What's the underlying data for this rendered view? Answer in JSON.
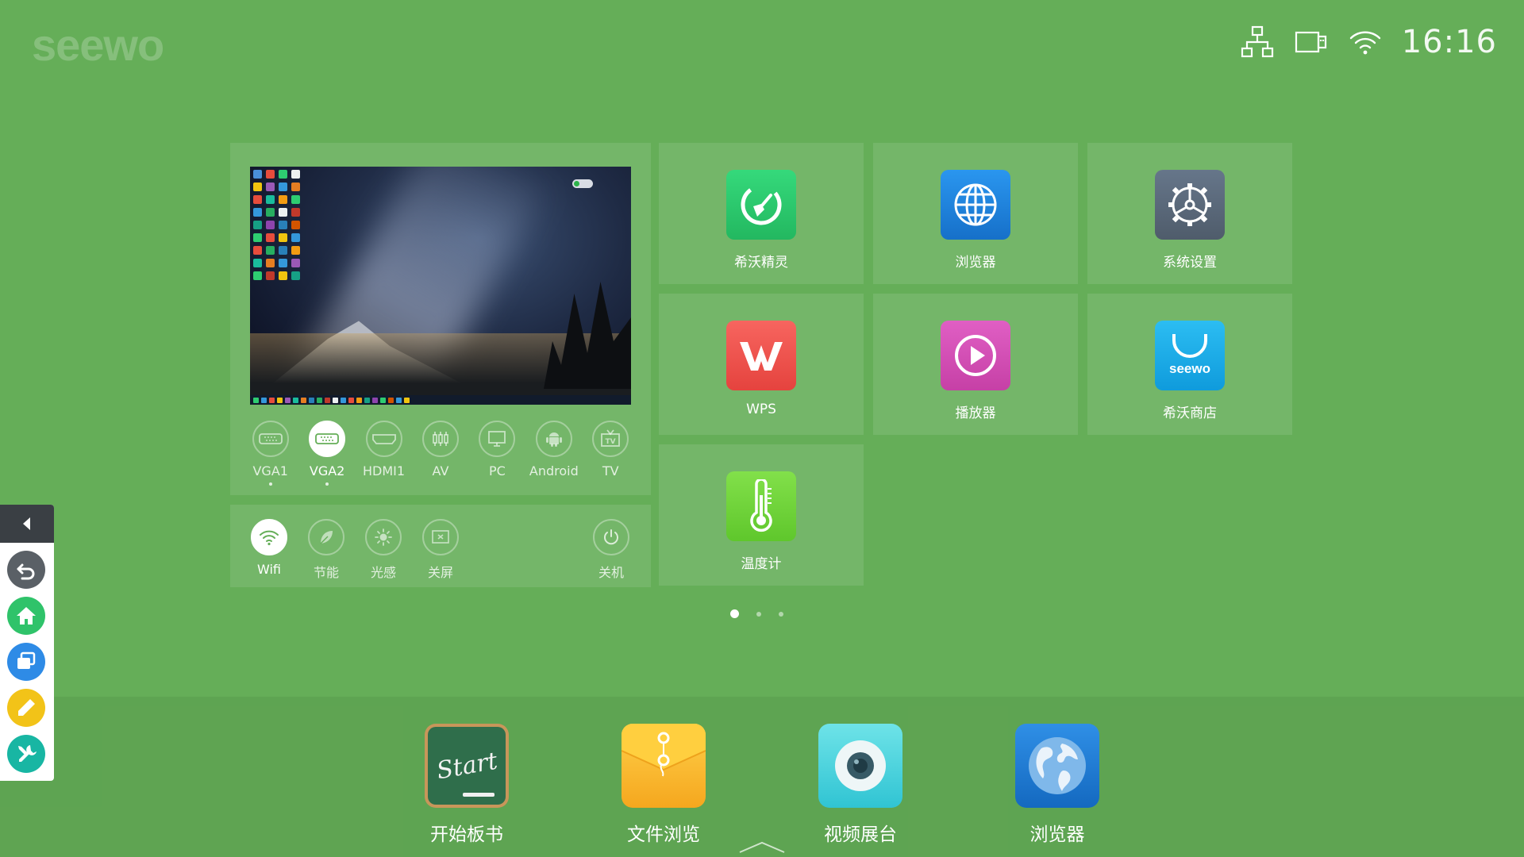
{
  "header": {
    "logo_text": "seewo",
    "clock": "16:16",
    "status_icons": [
      "network-icon",
      "usb-drive-icon",
      "wifi-icon"
    ]
  },
  "sources": {
    "items": [
      {
        "label": "VGA1",
        "icon": "vga-port-icon",
        "active": false,
        "has_dot": true
      },
      {
        "label": "VGA2",
        "icon": "vga-port-icon",
        "active": true,
        "has_dot": true
      },
      {
        "label": "HDMI1",
        "icon": "hdmi-port-icon",
        "active": false,
        "has_dot": false
      },
      {
        "label": "AV",
        "icon": "av-port-icon",
        "active": false,
        "has_dot": false
      },
      {
        "label": "PC",
        "icon": "pc-icon",
        "active": false,
        "has_dot": false
      },
      {
        "label": "Android",
        "icon": "android-icon",
        "active": false,
        "has_dot": false
      },
      {
        "label": "TV",
        "icon": "tv-icon",
        "active": false,
        "has_dot": false
      }
    ]
  },
  "quick_settings": {
    "wifi": "Wifi",
    "eco": "节能",
    "light_sensor": "光感",
    "screen_off": "关屏",
    "power_off": "关机"
  },
  "apps": [
    {
      "label": "希沃精灵",
      "icon": "cleaner-broom-icon",
      "color": "#2fcf72"
    },
    {
      "label": "浏览器",
      "icon": "globe-icon",
      "color": "#1e86e0"
    },
    {
      "label": "系统设置",
      "icon": "settings-gear-icon",
      "color": "#5c6a7a"
    },
    {
      "label": "WPS",
      "icon": "wps-icon",
      "color": "#f0534e"
    },
    {
      "label": "播放器",
      "icon": "play-icon",
      "color": "#d64fb7"
    },
    {
      "label": "希沃商店",
      "icon": "shopping-bag-icon",
      "color": "#1aaee8",
      "icon_text": "seewo"
    },
    {
      "label": "温度计",
      "icon": "thermometer-icon",
      "color": "#6fd63a"
    }
  ],
  "pager": {
    "pages": 3,
    "current": 1
  },
  "dock": [
    {
      "label": "开始板书",
      "icon": "blackboard-icon",
      "icon_text": "Start"
    },
    {
      "label": "文件浏览",
      "icon": "folder-envelope-icon"
    },
    {
      "label": "视频展台",
      "icon": "camera-lens-icon"
    },
    {
      "label": "浏览器",
      "icon": "earth-globe-icon"
    }
  ],
  "sidebar": {
    "items": [
      {
        "icon": "back-arrow-icon",
        "color": "#5a6066"
      },
      {
        "icon": "home-icon",
        "color": "#2fc36a"
      },
      {
        "icon": "windows-icon",
        "color": "#2e8be6"
      },
      {
        "icon": "pen-icon",
        "color": "#f2c318"
      },
      {
        "icon": "tools-icon",
        "color": "#18b6a3"
      }
    ]
  },
  "colors": {
    "background": "#65ae58",
    "tile": "rgba(255,255,255,0.10)"
  }
}
